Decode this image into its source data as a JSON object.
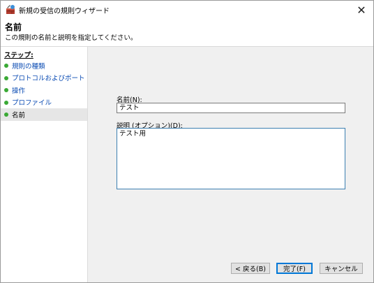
{
  "window": {
    "title": "新規の受信の規則ウィザード",
    "close_glyph": "✕"
  },
  "header": {
    "title": "名前",
    "subtitle": "この規則の名前と説明を指定してください。"
  },
  "steps": {
    "heading": "ステップ:",
    "items": [
      {
        "label": "規則の種類",
        "current": false
      },
      {
        "label": "プロトコルおよびポート",
        "current": false
      },
      {
        "label": "操作",
        "current": false
      },
      {
        "label": "プロファイル",
        "current": false
      },
      {
        "label": "名前",
        "current": true
      }
    ],
    "dot_color": "#3aa935"
  },
  "form": {
    "name_label": "名前(N):",
    "name_value": "テスト",
    "description_label": "説明 (オプション)(D):",
    "description_value": "テスト用"
  },
  "buttons": {
    "back": "< 戻る(B)",
    "finish": "完了(F)",
    "cancel": "キャンセル"
  },
  "colors": {
    "link": "#0a4bb3",
    "accent": "#0078d7"
  }
}
